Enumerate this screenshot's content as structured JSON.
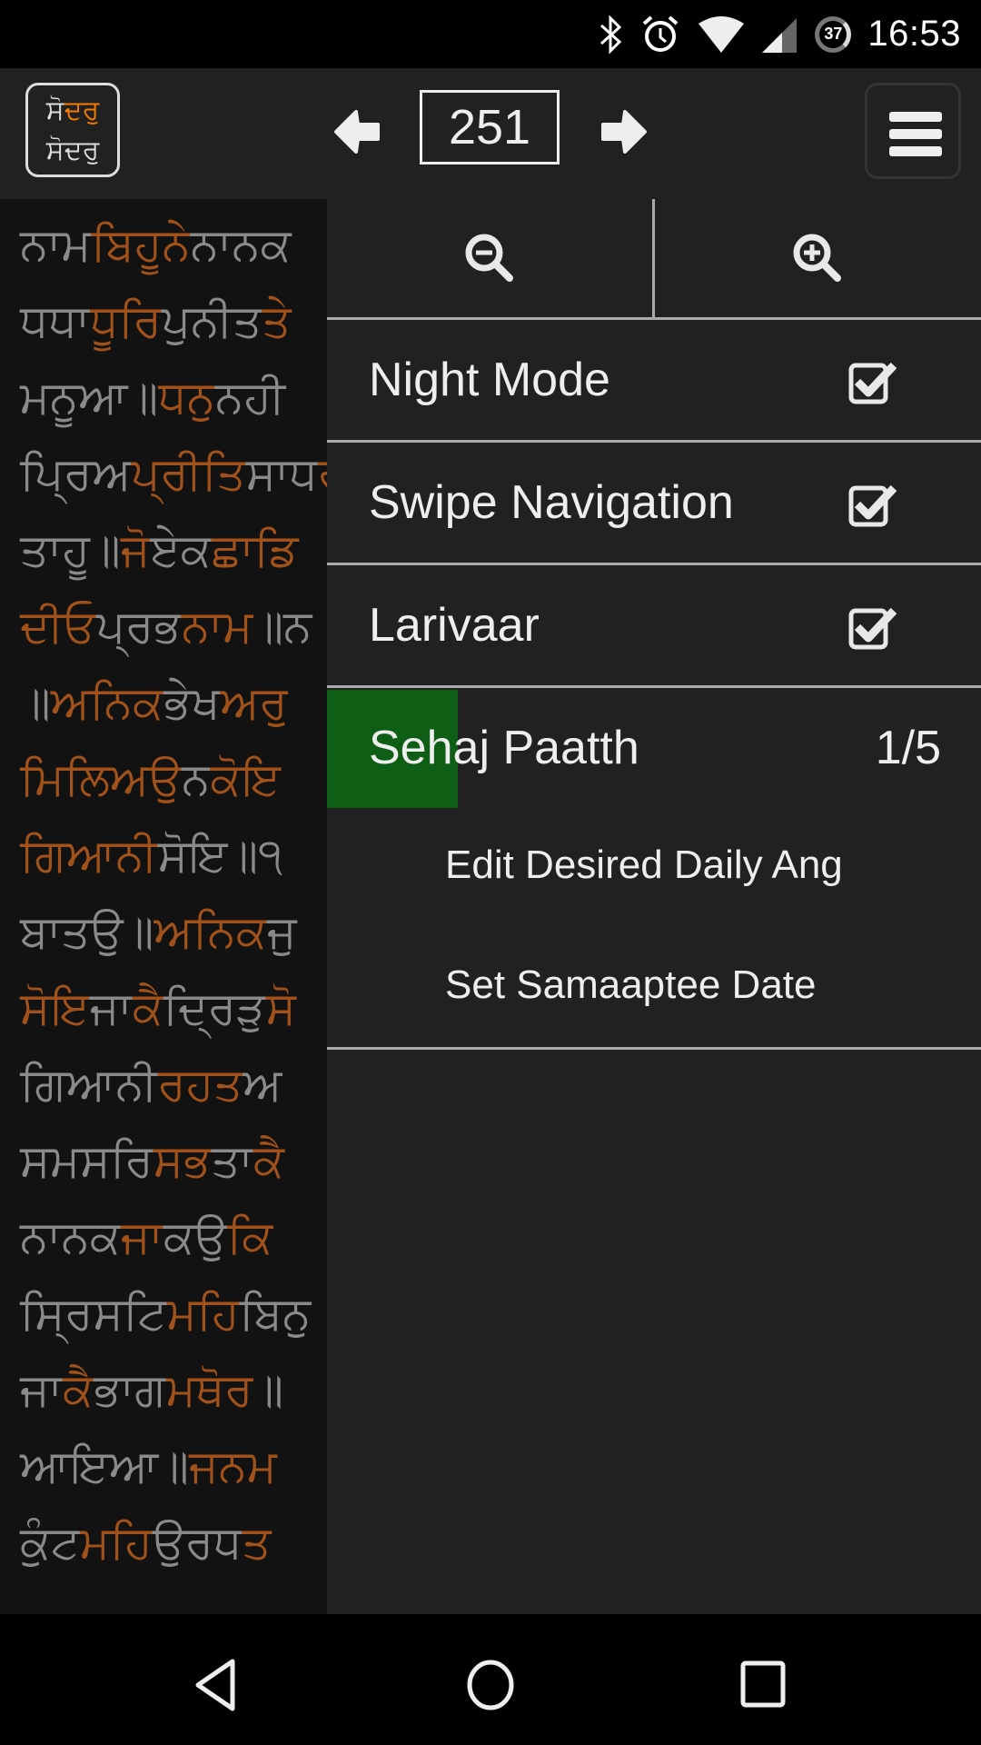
{
  "status_bar": {
    "time": "16:53",
    "battery_level": "37",
    "icons": [
      "bluetooth-icon",
      "alarm-icon",
      "wifi-icon",
      "cell-signal-icon",
      "battery-icon"
    ]
  },
  "toolbar": {
    "logo_text": {
      "line1_a": "ਸੋ",
      "line1_b": "ਦਰੁ",
      "line2": "ਸੋਦਰੁ"
    },
    "ang_number": "251",
    "prev_icon": "arrow-left-icon",
    "next_icon": "arrow-right-icon",
    "menu_icon": "hamburger-menu-icon"
  },
  "colors": {
    "highlight": "#a0521a",
    "text": "#8a8a8a",
    "progress": "#0f5e16",
    "logo_accent": "#f57c00"
  },
  "reader": {
    "lines": [
      [
        [
          "g",
          "ਨਾਮ"
        ],
        [
          "o",
          "ਬਿਹੂਨੇ"
        ],
        [
          "g",
          "ਨਾਨਕ"
        ]
      ],
      [
        [
          "g",
          "ਧਧਾ"
        ],
        [
          "o",
          "ਧੂਰਿ"
        ],
        [
          "g",
          "ਪੁਨੀਤ"
        ],
        [
          "o",
          "ਤੇ"
        ]
      ],
      [
        [
          "g",
          "ਮਨੂਆ॥"
        ],
        [
          "o",
          "ਧਨੁ"
        ],
        [
          "g",
          "ਨਹੀ"
        ]
      ],
      [
        [
          "g",
          "ਪ੍ਰਿਅ"
        ],
        [
          "o",
          "ਪ੍ਰੀਤਿ"
        ],
        [
          "g",
          "ਸਾਧ"
        ],
        [
          "o",
          "ਰ"
        ]
      ],
      [
        [
          "g",
          "ਤਾਹੂ॥"
        ],
        [
          "o",
          "ਜੋ"
        ],
        [
          "g",
          "ਏਕ"
        ],
        [
          "o",
          "ਛਾਡਿ"
        ]
      ],
      [
        [
          "o",
          "ਦੀਓ"
        ],
        [
          "g",
          "ਪ੍ਰਭ"
        ],
        [
          "o",
          "ਨਾਮ"
        ],
        [
          "g",
          "॥ਨ"
        ]
      ],
      [
        [
          "g",
          "॥"
        ],
        [
          "o",
          "ਅਨਿਕ"
        ],
        [
          "g",
          "ਭੇਖ"
        ],
        [
          "o",
          "ਅਰੁ"
        ]
      ],
      [
        [
          "o",
          "ਮਿਲਿਅਉ"
        ],
        [
          "g",
          "ਨ"
        ],
        [
          "o",
          "ਕੋਇ"
        ]
      ],
      [
        [
          "o",
          "ਗਿਆਨੀ"
        ],
        [
          "g",
          "ਸੋਇ॥੧"
        ]
      ],
      [
        [
          "g",
          "ਬਾਤਉ॥"
        ],
        [
          "o",
          "ਅਨਿਕ"
        ],
        [
          "g",
          "ਜੁ"
        ]
      ],
      [
        [
          "o",
          "ਸੋਇ"
        ],
        [
          "g",
          "ਜਾ"
        ],
        [
          "o",
          "ਕੈ"
        ],
        [
          "g",
          "ਦ੍ਰਿੜੁ"
        ],
        [
          "o",
          "ਸੋ"
        ]
      ],
      [
        [
          "g",
          "ਗਿਆਨੀ"
        ],
        [
          "o",
          "ਰਹਤ"
        ],
        [
          "g",
          "ਅ"
        ]
      ],
      [
        [
          "g",
          "ਸਮਸਰਿ"
        ],
        [
          "o",
          "ਸਭ"
        ],
        [
          "g",
          "ਤਾ"
        ],
        [
          "o",
          "ਕੈ"
        ]
      ],
      [
        [
          "g",
          "ਨਾਨਕ"
        ],
        [
          "o",
          "ਜਾ"
        ],
        [
          "g",
          "ਕਉ"
        ],
        [
          "o",
          "ਕਿ"
        ]
      ],
      [
        [
          "g",
          "ਸ੍ਰਿਸਟਿ"
        ],
        [
          "o",
          "ਮਹਿ"
        ],
        [
          "g",
          "ਬਿਨੁ"
        ]
      ],
      [
        [
          "g",
          "ਜਾ"
        ],
        [
          "o",
          "ਕੈ"
        ],
        [
          "g",
          "ਭਾਗ"
        ],
        [
          "o",
          "ਮਥੋਰ"
        ],
        [
          "g",
          "॥"
        ]
      ],
      [
        [
          "g",
          "ਆਇਆ॥"
        ],
        [
          "o",
          "ਜਨਮ"
        ]
      ],
      [
        [
          "g",
          "ਕੁੰਟ"
        ],
        [
          "o",
          "ਮਹਿ"
        ],
        [
          "g",
          "ਉਰਧ"
        ],
        [
          "o",
          "ਤ"
        ]
      ]
    ]
  },
  "drawer": {
    "zoom_out_icon": "zoom-out-icon",
    "zoom_in_icon": "zoom-in-icon",
    "night_mode": {
      "label": "Night Mode",
      "checked": true
    },
    "swipe_navigation": {
      "label": "Swipe Navigation",
      "checked": true
    },
    "larivaar": {
      "label": "Larivaar",
      "checked": true
    },
    "sehaj_paatth": {
      "label": "Sehaj Paatth",
      "count": "1/5",
      "progress": 0.2
    },
    "edit_daily_ang": "Edit Desired Daily Ang",
    "set_samaaptee_date": "Set Samaaptee Date"
  },
  "nav_bar": {
    "icons": [
      "back-icon",
      "home-icon",
      "recents-icon"
    ]
  }
}
